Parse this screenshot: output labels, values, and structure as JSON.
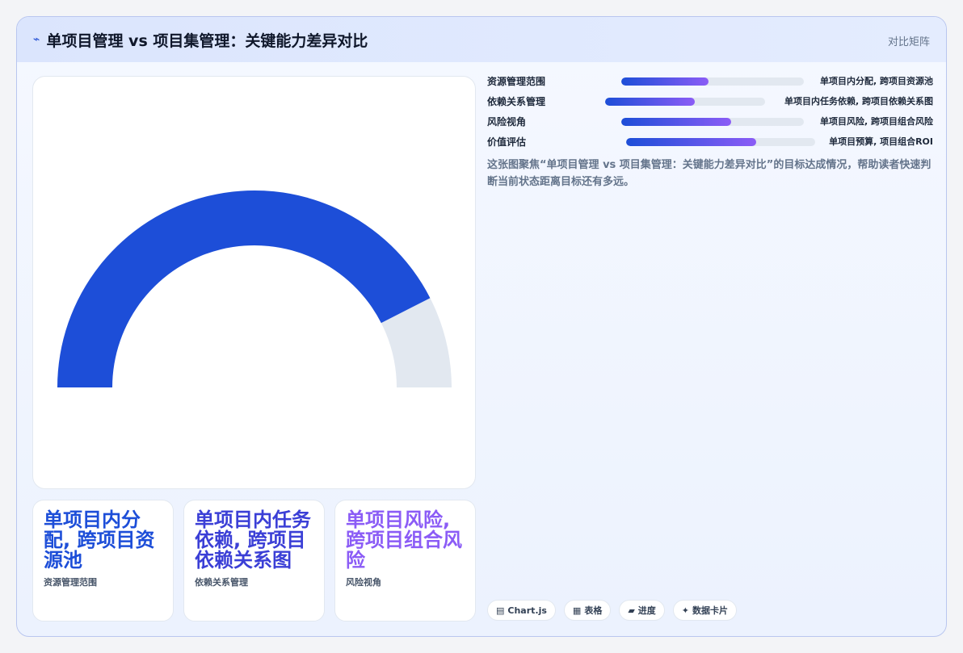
{
  "header": {
    "icon": "⌁",
    "title": "单项目管理 vs 项目集管理：关键能力差异对比",
    "tag": "对比矩阵"
  },
  "chart_data": {
    "type": "gauge",
    "value": 0.85,
    "min": 0,
    "max": 1,
    "colors": {
      "fill": "#1d4ed8",
      "track": "#e2e8f0"
    }
  },
  "metrics": [
    {
      "label": "资源管理范围",
      "value": "单项目内分配, 跨项目资源池",
      "progress": 0.48
    },
    {
      "label": "依赖关系管理",
      "value": "单项目内任务依赖, 跨项目依赖关系图",
      "progress": 0.56
    },
    {
      "label": "风险视角",
      "value": "单项目风险, 跨项目组合风险",
      "progress": 0.6
    },
    {
      "label": "价值评估",
      "value": "单项目预算, 项目组合ROI",
      "progress": 0.69
    }
  ],
  "description": "这张图聚焦“单项目管理 vs 项目集管理：关键能力差异对比”的目标达成情况，帮助读者快速判断当前状态距离目标还有多远。",
  "kpis": [
    {
      "value": "单项目内分配, 跨项目资源池",
      "label": "资源管理范围"
    },
    {
      "value": "单项目内任务依赖, 跨项目依赖关系图",
      "label": "依赖关系管理"
    },
    {
      "value": "单项目风险, 跨项目组合风险",
      "label": "风险视角"
    }
  ],
  "chips": [
    {
      "icon": "▤",
      "label": "Chart.js"
    },
    {
      "icon": "▦",
      "label": "表格"
    },
    {
      "icon": "▰",
      "label": "进度"
    },
    {
      "icon": "✦",
      "label": "数据卡片"
    }
  ]
}
